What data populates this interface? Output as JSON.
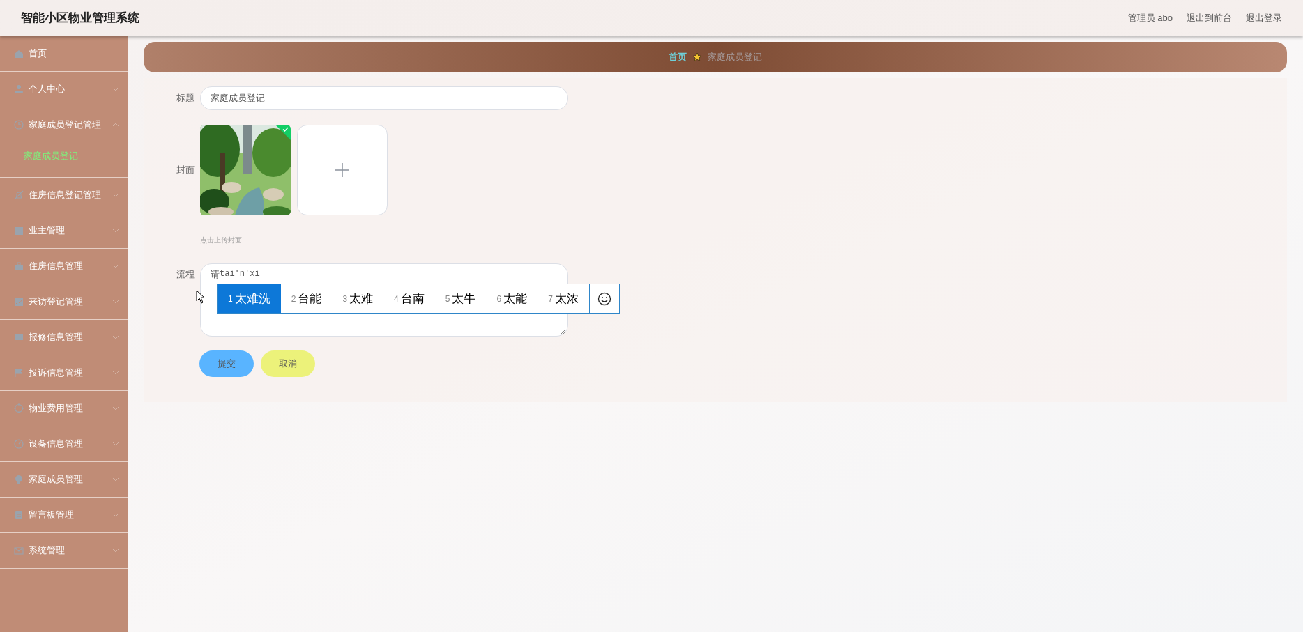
{
  "header": {
    "title": "智能小区物业管理系统",
    "user": "管理员 abo",
    "links": [
      "退出到前台",
      "退出登录"
    ]
  },
  "sidebar": {
    "items": [
      {
        "label": "首页",
        "has_arrow": false
      },
      {
        "label": "个人中心",
        "expanded": false,
        "has_arrow": true
      },
      {
        "label": "家庭成员登记管理",
        "expanded": true,
        "has_arrow": true,
        "children": [
          {
            "label": "家庭成员登记",
            "selected": true
          }
        ]
      },
      {
        "label": "住房信息登记管理",
        "expanded": false,
        "has_arrow": true
      },
      {
        "label": "业主管理",
        "expanded": false,
        "has_arrow": true
      },
      {
        "label": "住房信息管理",
        "expanded": false,
        "has_arrow": true
      },
      {
        "label": "来访登记管理",
        "expanded": false,
        "has_arrow": true
      },
      {
        "label": "报修信息管理",
        "expanded": false,
        "has_arrow": true
      },
      {
        "label": "投诉信息管理",
        "expanded": false,
        "has_arrow": true
      },
      {
        "label": "物业费用管理",
        "expanded": false,
        "has_arrow": true
      },
      {
        "label": "设备信息管理",
        "expanded": false,
        "has_arrow": true
      },
      {
        "label": "家庭成员管理",
        "expanded": false,
        "has_arrow": true
      },
      {
        "label": "留言板管理",
        "expanded": false,
        "has_arrow": true
      },
      {
        "label": "系统管理",
        "expanded": false,
        "has_arrow": true
      }
    ]
  },
  "breadcrumb": [
    "首页",
    "家庭成员登记"
  ],
  "form": {
    "title_label": "标题",
    "title_value": "家庭成员登记",
    "cover_label": "封面",
    "cover_uploaded": true,
    "cover_hint": "点击上传封面",
    "process_label": "流程",
    "process_value": "请",
    "composition": "tai'n'xi",
    "buttons": [
      {
        "label": "提交",
        "kind": "primary"
      },
      {
        "label": "取消",
        "kind": "cancel"
      }
    ]
  },
  "ime": {
    "candidates": [
      {
        "index": "1",
        "text": "太难洗",
        "selected": true
      },
      {
        "index": "2",
        "text": "台能",
        "selected": false
      },
      {
        "index": "3",
        "text": "太难",
        "selected": false
      },
      {
        "index": "4",
        "text": "台南",
        "selected": false
      },
      {
        "index": "5",
        "text": "太牛",
        "selected": false
      },
      {
        "index": "6",
        "text": "太能",
        "selected": false
      },
      {
        "index": "7",
        "text": "太浓",
        "selected": false
      }
    ]
  }
}
